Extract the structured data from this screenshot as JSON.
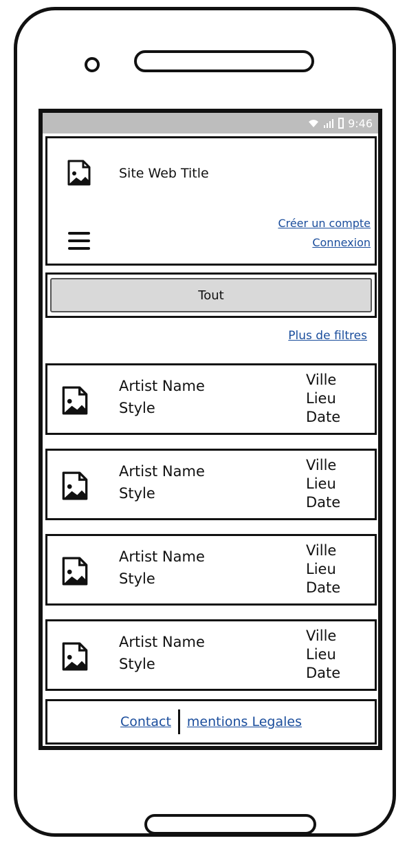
{
  "statusbar": {
    "time": "9:46",
    "icons": [
      "wifi-icon",
      "signal-icon",
      "battery-icon"
    ]
  },
  "header": {
    "logo_icon": "image-placeholder-icon",
    "site_title": "Site Web Title",
    "menu_icon": "hamburger-menu-icon",
    "create_account_label": "Créer un compte",
    "login_label": "Connexion"
  },
  "filters": {
    "active_label": "Tout",
    "more_filters_label": "Plus de filtres"
  },
  "events": [
    {
      "artist": "Artist Name",
      "style": "Style",
      "city": "Ville",
      "venue": "Lieu",
      "date": "Date"
    },
    {
      "artist": "Artist Name",
      "style": "Style",
      "city": "Ville",
      "venue": "Lieu",
      "date": "Date"
    },
    {
      "artist": "Artist Name",
      "style": "Style",
      "city": "Ville",
      "venue": "Lieu",
      "date": "Date"
    },
    {
      "artist": "Artist Name",
      "style": "Style",
      "city": "Ville",
      "venue": "Lieu",
      "date": "Date"
    }
  ],
  "footer": {
    "contact_label": "Contact",
    "legal_label": "mentions Legales"
  },
  "colors": {
    "link": "#1a4d9c",
    "statusbar": "#bdbdbd",
    "filter_button": "#d9d9d9"
  }
}
